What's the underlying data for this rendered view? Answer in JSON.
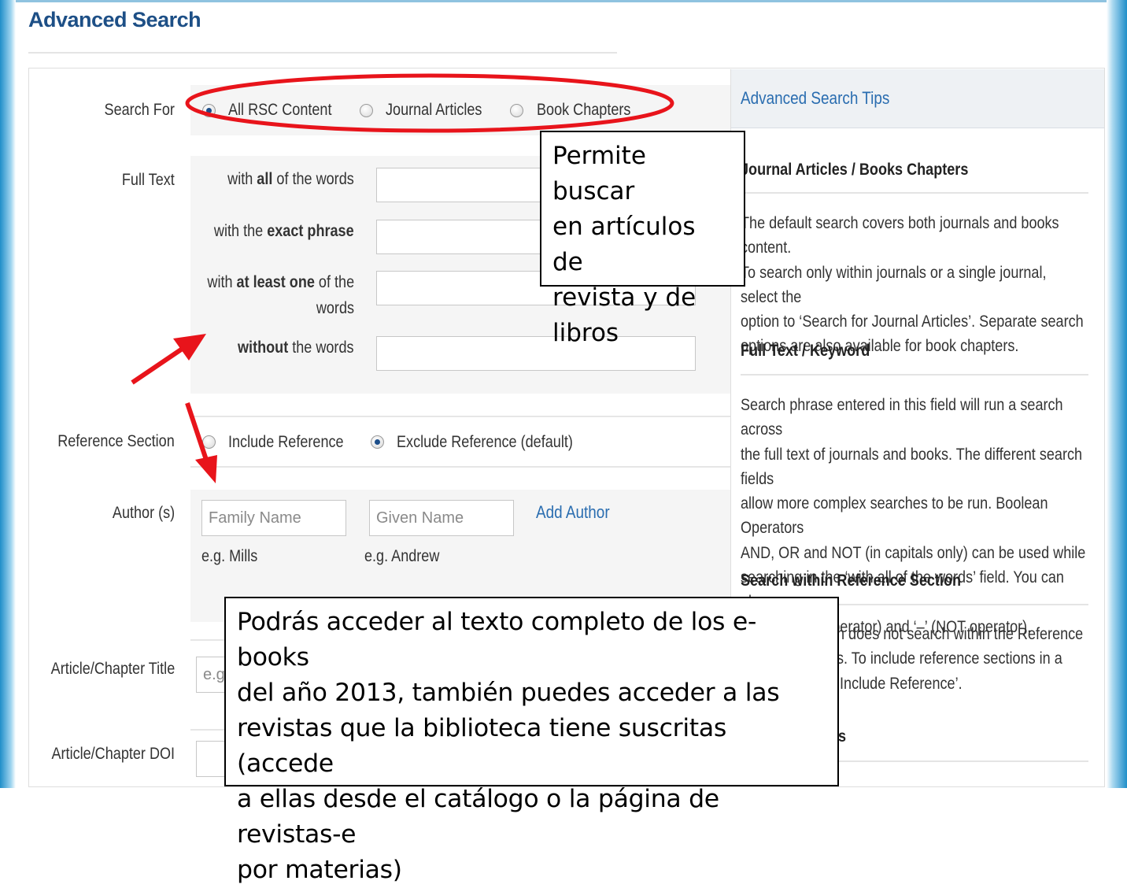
{
  "page": {
    "title": "Advanced Search"
  },
  "search_for": {
    "label": "Search For",
    "options": [
      {
        "label": "All RSC Content",
        "checked": true
      },
      {
        "label": "Journal Articles",
        "checked": false
      },
      {
        "label": "Book Chapters",
        "checked": false
      }
    ]
  },
  "full_text": {
    "label": "Full Text",
    "all_words": {
      "pre": "with ",
      "bold": "all",
      "post": " of the words"
    },
    "exact_phrase": {
      "pre": "with the ",
      "bold": "exact phrase",
      "post": ""
    },
    "at_least_one": {
      "pre": "with ",
      "bold": "at least one",
      "post": " of the",
      "line2": "words"
    },
    "without": {
      "pre": "",
      "bold": "without",
      "post": " the words"
    }
  },
  "reference_section": {
    "label": "Reference Section",
    "options": [
      {
        "label": "Include Reference",
        "checked": false
      },
      {
        "label": "Exclude Reference (default)",
        "checked": true
      }
    ]
  },
  "author": {
    "label": "Author (s)",
    "family_placeholder": "Family Name",
    "given_placeholder": "Given Name",
    "add_author": "Add Author",
    "family_example": "e.g. Mills",
    "given_example": "e.g. Andrew"
  },
  "article_title": {
    "label": "Article/Chapter Title",
    "placeholder": "e.g"
  },
  "article_doi": {
    "label": "Article/Chapter DOI"
  },
  "tips": {
    "header": "Advanced Search Tips",
    "sections": [
      {
        "heading": "Journal Articles / Books Chapters",
        "lines": [
          "The default search covers both journals and books content.",
          "To search only within journals or a single journal, select the",
          "option to ‘Search for Journal Articles’. Separate search",
          "options are also available for book chapters."
        ]
      },
      {
        "heading": "Full Text / Keyword",
        "lines": [
          "Search phrase entered in this field will run a search across",
          "the full text of journals and books. The different search fields",
          "allow more complex searches to be run. Boolean Operators",
          "AND, OR and NOT (in capitals only) can be used while",
          "searching in the ‘with all of the words’ field. You can also",
          "use ‘+’ (AND operator) and ‘–’ (NOT operator)."
        ]
      },
      {
        "heading": "Search within Reference Section",
        "lines": [
          "h does not search within the Reference",
          "s. To include reference sections in a",
          "‘Include Reference’."
        ]
      },
      {
        "heading": "s",
        "lines": []
      }
    ]
  },
  "callouts": {
    "first": [
      "Permite buscar",
      "en artículos de",
      "revista y de",
      "libros"
    ],
    "second": [
      "Podrás acceder al texto completo de los e-books",
      "del año 2013, también puedes acceder a las",
      "revistas que la biblioteca tiene suscritas (accede",
      "a ellas desde el catálogo o la página de revistas-e",
      "por materias)"
    ]
  },
  "annotation_colors": {
    "ellipse": "#e8141b",
    "arrows": "#e8141b"
  }
}
